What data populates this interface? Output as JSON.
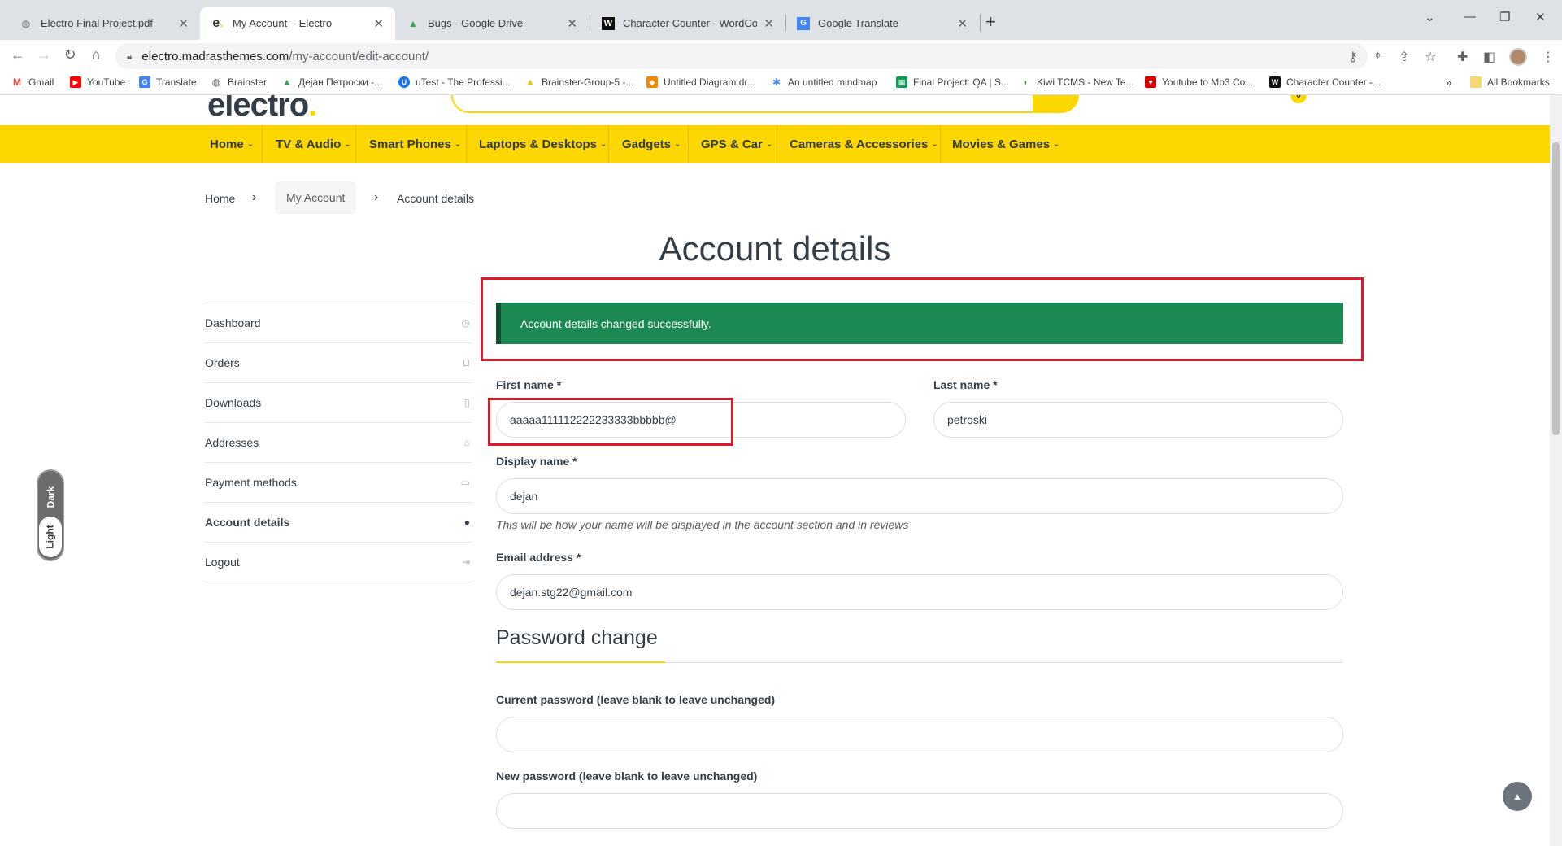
{
  "browser": {
    "tabs": [
      {
        "title": "Electro Final Project.pdf",
        "icon": "globe-icon"
      },
      {
        "title": "My Account – Electro",
        "icon": "electro-icon"
      },
      {
        "title": "Bugs - Google Drive",
        "icon": "drive-icon"
      },
      {
        "title": "Character Counter - WordCount",
        "icon": "wordcounter-icon"
      },
      {
        "title": "Google Translate",
        "icon": "translate-icon"
      }
    ],
    "url_host": "electro.madrasthemes.com",
    "url_path": "/my-account/edit-account/",
    "bookmarks": [
      {
        "label": "Gmail",
        "color": "#ea4335",
        "glyph": "M"
      },
      {
        "label": "YouTube",
        "color": "#ff0000",
        "glyph": "▶"
      },
      {
        "label": "Translate",
        "color": "#4285f4",
        "glyph": "G"
      },
      {
        "label": "Brainster",
        "color": "#5f6368",
        "glyph": "◎"
      },
      {
        "label": "Дејан Петроски -...",
        "color": "#34a853",
        "glyph": "▲"
      },
      {
        "label": "uTest - The Professi...",
        "color": "#1a73e8",
        "glyph": "U"
      },
      {
        "label": "Brainster-Group-5 -...",
        "color": "#fbbc04",
        "glyph": "▲"
      },
      {
        "label": "Untitled Diagram.dr...",
        "color": "#f08705",
        "glyph": "◆"
      },
      {
        "label": "An untitled mindmap",
        "color": "#4285f4",
        "glyph": "✱"
      },
      {
        "label": "Final Project: QA | S...",
        "color": "#0f9d58",
        "glyph": "▦"
      },
      {
        "label": "Kiwi TCMS - New Te...",
        "color": "#3c8d2f",
        "glyph": "◗"
      },
      {
        "label": "Youtube to Mp3 Co...",
        "color": "#d50000",
        "glyph": "♥"
      },
      {
        "label": "Character Counter -...",
        "color": "#111111",
        "glyph": "W"
      }
    ],
    "all_bookmarks": "All Bookmarks"
  },
  "site": {
    "nav": [
      "Home",
      "TV & Audio",
      "Smart Phones",
      "Laptops & Desktops",
      "Gadgets",
      "GPS & Car",
      "Cameras & Accessories",
      "Movies & Games"
    ],
    "cart_count": "0",
    "breadcrumb": {
      "home": "Home",
      "current_parent": "My Account",
      "current": "Account details"
    },
    "page_title": "Account details",
    "sidebar": [
      {
        "label": "Dashboard",
        "icon": "dashboard-icon",
        "glyph": "◷"
      },
      {
        "label": "Orders",
        "icon": "basket-icon",
        "glyph": "⊔"
      },
      {
        "label": "Downloads",
        "icon": "file-icon",
        "glyph": "▯"
      },
      {
        "label": "Addresses",
        "icon": "home-icon",
        "glyph": "⌂"
      },
      {
        "label": "Payment methods",
        "icon": "card-icon",
        "glyph": "▭"
      },
      {
        "label": "Account details",
        "icon": "user-icon",
        "glyph": "●"
      },
      {
        "label": "Logout",
        "icon": "logout-icon",
        "glyph": "⇥"
      }
    ],
    "notice": "Account details changed successfully.",
    "form": {
      "first_name_label": "First name *",
      "first_name": "aaaaa111112222233333bbbbb@",
      "last_name_label": "Last name *",
      "last_name": "petroski",
      "display_name_label": "Display name *",
      "display_name": "dejan",
      "display_hint": "This will be how your name will be displayed in the account section and in reviews",
      "email_label": "Email address *",
      "email": "dejan.stg22@gmail.com",
      "password_section": "Password change",
      "current_password_label": "Current password (leave blank to leave unchanged)",
      "new_password_label": "New password (leave blank to leave unchanged)"
    },
    "mode_toggle": {
      "dark": "Dark",
      "light": "Light"
    }
  },
  "colors": {
    "brand_yellow": "#fed700",
    "success_green": "#1d8952",
    "highlight_red": "#e0192a"
  }
}
